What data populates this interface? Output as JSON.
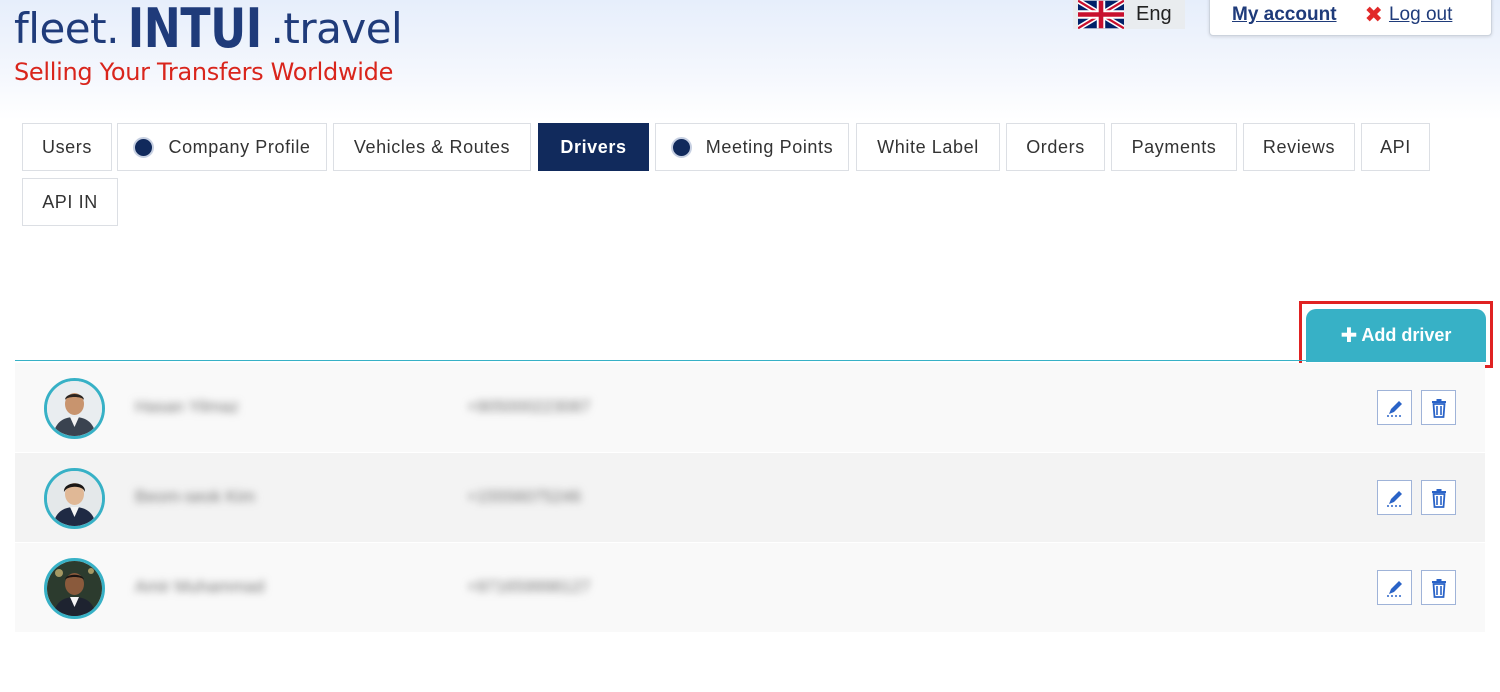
{
  "header": {
    "logo": {
      "part1": "fleet.",
      "part2": "INTUI",
      "part3": ".travel",
      "tagline": "Selling Your Transfers Worldwide"
    },
    "language": {
      "label": "Eng",
      "flag_icon": "uk-flag-icon"
    },
    "account": {
      "my_account": "My account",
      "logout": "Log out"
    }
  },
  "tabs": [
    {
      "label": "Users",
      "dot": false,
      "active": false
    },
    {
      "label": "Company Profile",
      "dot": true,
      "active": false
    },
    {
      "label": "Vehicles & Routes",
      "dot": false,
      "active": false
    },
    {
      "label": "Drivers",
      "dot": false,
      "active": true
    },
    {
      "label": "Meeting Points",
      "dot": true,
      "active": false
    },
    {
      "label": "White Label",
      "dot": false,
      "active": false
    },
    {
      "label": "Orders",
      "dot": false,
      "active": false
    },
    {
      "label": "Payments",
      "dot": false,
      "active": false
    },
    {
      "label": "Reviews",
      "dot": false,
      "active": false
    },
    {
      "label": "API",
      "dot": false,
      "active": false
    },
    {
      "label": "API IN",
      "dot": false,
      "active": false
    }
  ],
  "actions": {
    "add_driver": "Add driver",
    "add_icon": "plus-icon"
  },
  "drivers": [
    {
      "name": "Hasan Yilmaz",
      "phone": "+905000223087"
    },
    {
      "name": "Beom-seok Kim",
      "phone": "+15556075246"
    },
    {
      "name": "Amir Muhammad",
      "phone": "+971659998127"
    }
  ],
  "colors": {
    "navy": "#112a5c",
    "teal": "#37b1c6",
    "red": "#d9251c",
    "highlight": "#e02222"
  }
}
